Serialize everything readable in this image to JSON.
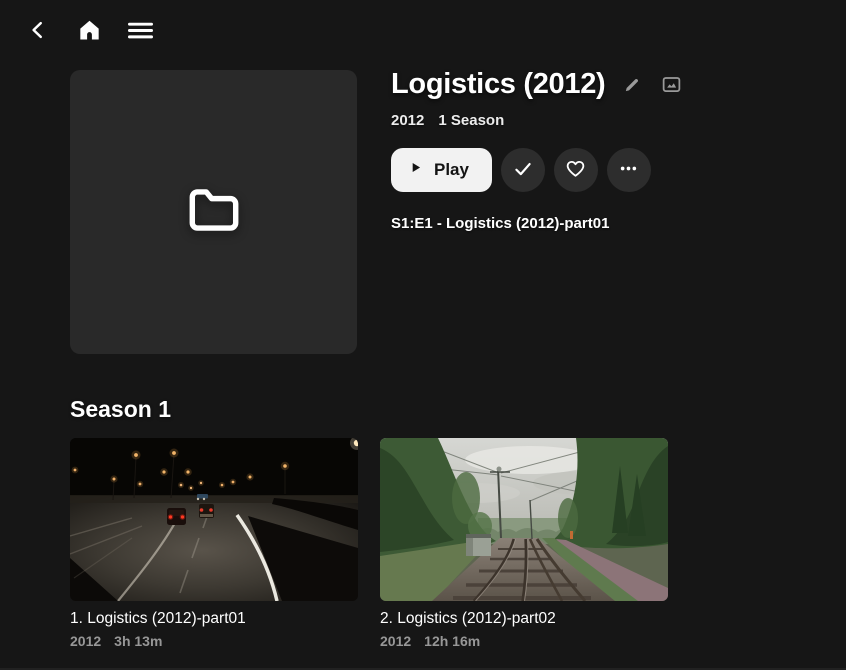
{
  "header": {
    "icons": [
      "chevron-left-icon",
      "home-icon",
      "menu-icon"
    ]
  },
  "details": {
    "title": "Logistics (2012)",
    "year": "2012",
    "season_count": "1 Season",
    "play_label": "Play",
    "next_up": "S1:E1 - Logistics (2012)-part01",
    "action_icons": [
      "play-icon",
      "check-icon",
      "heart-icon",
      "ellipsis-icon"
    ],
    "title_icons": [
      "pencil-icon",
      "image-icon"
    ],
    "poster_icon": "folder-icon"
  },
  "season": {
    "heading": "Season 1",
    "episodes": [
      {
        "title": "1. Logistics (2012)-part01",
        "year": "2012",
        "runtime": "3h 13m",
        "thumbnail": "night-highway-scene"
      },
      {
        "title": "2. Logistics (2012)-part02",
        "year": "2012",
        "runtime": "12h 16m",
        "thumbnail": "railway-forest-scene"
      }
    ]
  },
  "colors": {
    "background": "#161616",
    "poster_surface": "#292929",
    "circle_button": "#2d2d2d",
    "play_button": "#f2f2f2",
    "text_primary": "#ffffff",
    "text_secondary": "#979797",
    "icon_muted": "#9a9a9a"
  }
}
